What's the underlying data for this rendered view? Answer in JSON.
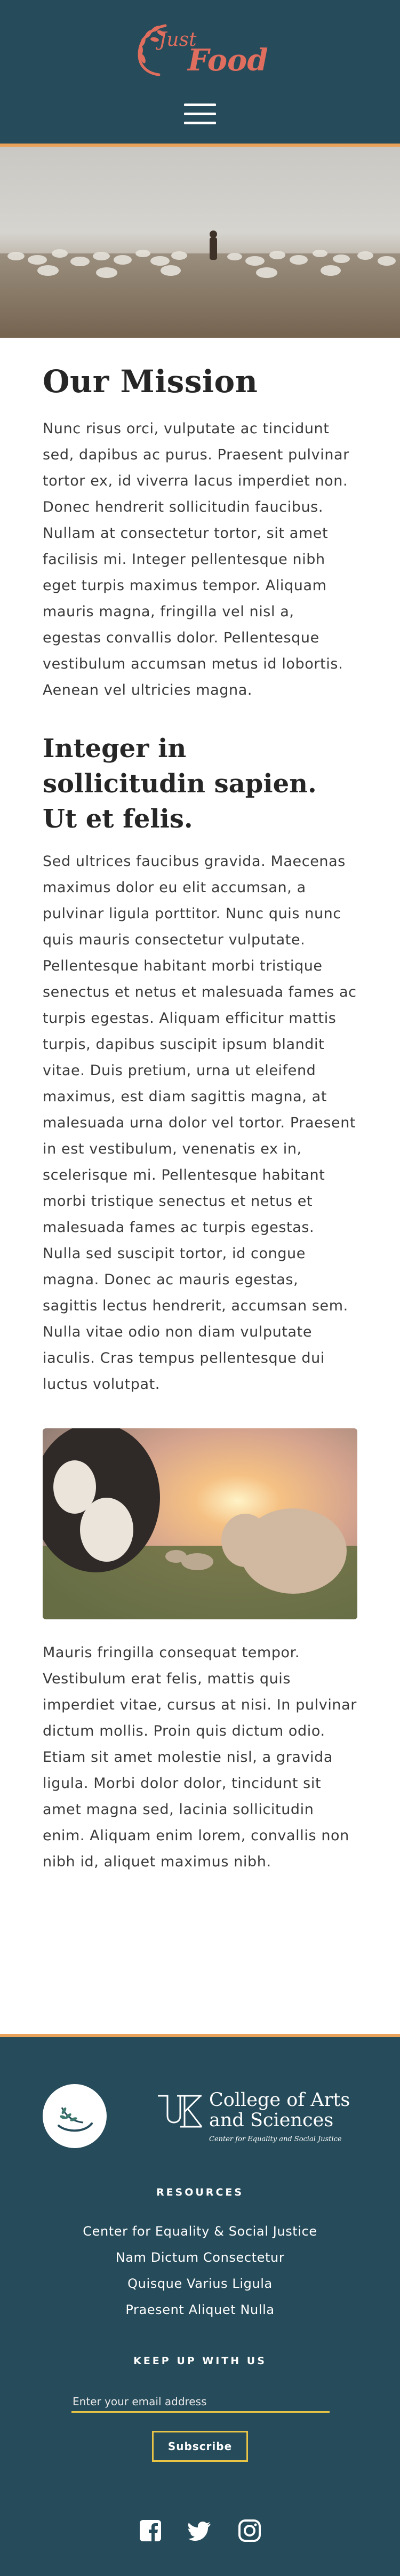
{
  "header": {
    "logo_text_1": "Just",
    "logo_text_2": "Food",
    "menu_icon": "hamburger-menu-icon"
  },
  "main": {
    "mission_title": "Our Mission",
    "mission_text": "Nunc risus orci, vulputate ac tincidunt sed, dapibus ac purus. Praesent pulvinar tortor ex, id viverra lacus imperdiet non. Donec hendrerit sollicitudin faucibus. Nullam at consectetur tortor, sit amet facilisis mi. Integer pellentesque nibh eget turpis maximus tempor. Aliquam mauris magna, fringilla vel nisl a, egestas convallis dolor. Pellentesque vestibulum accumsan metus id lobortis. Aenean vel ultricies magna.",
    "section2_title": "Integer in sollicitudin sapien. Ut et felis.",
    "section2_text": "Sed ultrices faucibus gravida. Maecenas maximus dolor eu elit accumsan, a pulvinar ligula porttitor. Nunc quis nunc quis mauris consectetur vulputate. Pellentesque habitant morbi tristique senectus et netus et malesuada fames ac turpis egestas. Aliquam efficitur mattis turpis, dapibus suscipit ipsum blandit vitae. Duis pretium, urna ut eleifend maximus, est diam sagittis magna, at malesuada urna dolor vel tortor. Praesent in est vestibulum, venenatis ex in, scelerisque mi. Pellentesque habitant morbi tristique senectus et netus et malesuada fames ac turpis egestas. Nulla sed suscipit tortor, id congue magna. Donec ac mauris egestas, sagittis lectus hendrerit, accumsan sem. Nulla vitae odio non diam vulputate iaculis. Cras tempus pellentesque dui luctus volutpat.",
    "section3_text": "Mauris fringilla consequat tempor. Vestibulum erat felis, mattis quis imperdiet vitae, cursus at nisi. In pulvinar dictum mollis. Proin quis dictum odio. Etiam sit amet molestie nisl, a gravida ligula. Morbi dolor dolor, tincidunt sit amet magna sed, lacinia sollicitudin enim. Aliquam enim lorem, convallis non nibh id, aliquet maximus nibh."
  },
  "footer": {
    "college_line_1": "College of Arts",
    "college_line_2": "and Sciences",
    "college_sub": "Center for Equality and Social Justice",
    "resources_heading": "RESOURCES",
    "resources_links": [
      "Center for Equality & Social Justice",
      "Nam Dictum Consectetur",
      "Quisque Varius Ligula",
      "Praesent Aliquet Nulla"
    ],
    "keep_up_heading": "KEEP UP WITH US",
    "email_placeholder": "Enter your email address",
    "subscribe_label": "Subscribe",
    "social_icons": [
      "facebook-icon",
      "twitter-icon",
      "instagram-icon"
    ]
  },
  "colors": {
    "header_bg": "#264b5a",
    "accent_orange": "#e8a25a",
    "accent_yellow": "#e8c547",
    "logo_red": "#e06e5e"
  }
}
